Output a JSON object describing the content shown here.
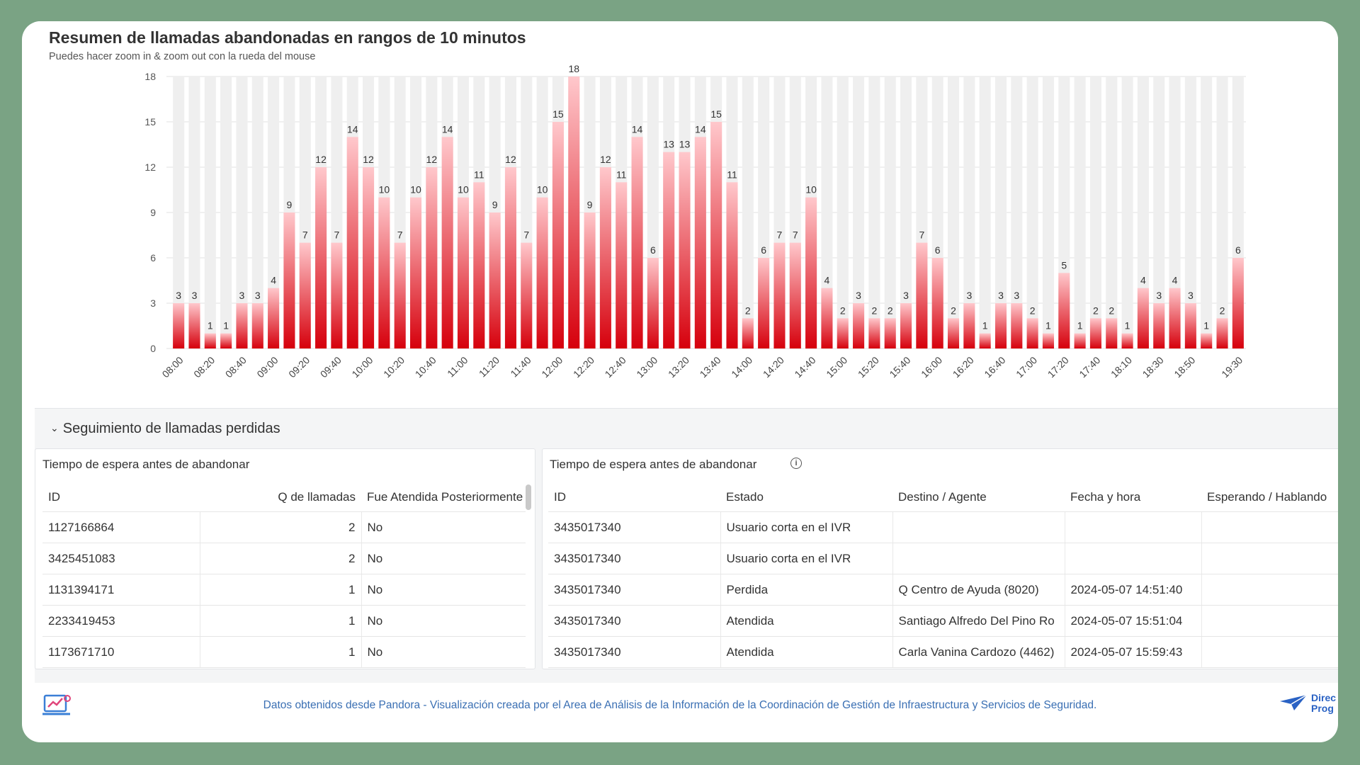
{
  "chart": {
    "title": "Resumen de llamadas abandonadas en rangos de 10 minutos",
    "subtitle": "Puedes hacer zoom in & zoom out con la rueda del mouse"
  },
  "chart_data": {
    "type": "bar",
    "title": "Resumen de llamadas abandonadas en rangos de 10 minutos",
    "xlabel": "",
    "ylabel": "",
    "ylim": [
      0,
      18
    ],
    "yticks": [
      0,
      3,
      6,
      9,
      12,
      15,
      18
    ],
    "categories": [
      "08:00",
      "08:10",
      "08:20",
      "08:30",
      "08:40",
      "08:50",
      "09:00",
      "09:10",
      "09:20",
      "09:30",
      "09:40",
      "09:50",
      "10:00",
      "10:10",
      "10:20",
      "10:30",
      "10:40",
      "10:50",
      "11:00",
      "11:10",
      "11:20",
      "11:30",
      "11:40",
      "11:50",
      "12:00",
      "12:10",
      "12:20",
      "12:30",
      "12:40",
      "12:50",
      "13:00",
      "13:10",
      "13:20",
      "13:30",
      "13:40",
      "13:50",
      "14:00",
      "14:10",
      "14:20",
      "14:30",
      "14:40",
      "14:50",
      "15:00",
      "15:10",
      "15:20",
      "15:30",
      "15:40",
      "15:50",
      "16:00",
      "16:10",
      "16:20",
      "16:30",
      "16:40",
      "16:50",
      "17:00",
      "17:10",
      "17:20",
      "17:30",
      "17:40",
      "17:50",
      "18:10",
      "18:20",
      "18:30",
      "18:40",
      "18:50",
      "19:00",
      "19:10",
      "19:30"
    ],
    "values": [
      3,
      3,
      1,
      1,
      3,
      3,
      4,
      9,
      7,
      12,
      7,
      14,
      12,
      10,
      7,
      10,
      12,
      14,
      10,
      11,
      9,
      12,
      7,
      10,
      15,
      18,
      9,
      12,
      11,
      14,
      6,
      13,
      13,
      14,
      15,
      11,
      2,
      6,
      7,
      7,
      10,
      4,
      2,
      3,
      2,
      2,
      3,
      7,
      6,
      2,
      3,
      1,
      3,
      3,
      2,
      1,
      5,
      1,
      2,
      2,
      1,
      4,
      3,
      4,
      3,
      1,
      2,
      6
    ],
    "shown_tick_labels": [
      "08:00",
      "08:20",
      "08:40",
      "09:00",
      "09:20",
      "09:40",
      "10:00",
      "10:20",
      "10:40",
      "11:00",
      "11:20",
      "11:40",
      "12:00",
      "12:20",
      "12:40",
      "13:00",
      "13:20",
      "13:40",
      "14:00",
      "14:20",
      "14:40",
      "15:00",
      "15:20",
      "15:40",
      "16:00",
      "16:20",
      "16:40",
      "17:00",
      "17:20",
      "17:40",
      "18:10",
      "18:30",
      "18:50",
      "19:30"
    ],
    "colors": {
      "bar_top": "#ffc8cc",
      "bar_bottom": "#d6000c",
      "track": "#efefef",
      "grid": "#e2e2e2"
    },
    "grid": true
  },
  "section": {
    "title": "Seguimiento de llamadas perdidas",
    "chevron": "chevron-down-icon"
  },
  "left_table": {
    "title": "Tiempo de espera antes de abandonar",
    "headers": [
      "ID",
      "Q de llamadas",
      "Fue Atendida Posteriormente"
    ],
    "rows": [
      [
        "1127166864",
        "2",
        "No"
      ],
      [
        "3425451083",
        "2",
        "No"
      ],
      [
        "1131394171",
        "1",
        "No"
      ],
      [
        "2233419453",
        "1",
        "No"
      ],
      [
        "1173671710",
        "1",
        "No"
      ]
    ]
  },
  "right_table": {
    "title": "Tiempo de espera antes de abandonar",
    "info_icon": "info-icon",
    "headers": [
      "ID",
      "Estado",
      "Destino / Agente",
      "Fecha y hora",
      "Esperando / Hablando"
    ],
    "rows": [
      [
        "3435017340",
        "Usuario corta en el IVR",
        "",
        "",
        ""
      ],
      [
        "3435017340",
        "Usuario corta en el IVR",
        "",
        "",
        ""
      ],
      [
        "3435017340",
        "Perdida",
        "Q Centro de Ayuda (8020)",
        "2024-05-07 14:51:40",
        ""
      ],
      [
        "3435017340",
        "Atendida",
        "Santiago Alfredo Del Pino Ro",
        "2024-05-07 15:51:04",
        ""
      ],
      [
        "3435017340",
        "Atendida",
        "Carla Vanina Cardozo (4462)",
        "2024-05-07 15:59:43",
        ""
      ]
    ]
  },
  "footer": {
    "text": "Datos obtenidos desde Pandora - Visualización creada por el Area de Análisis de la Información de la Coordinación de Gestión de Infraestructura y Servicios de Seguridad.",
    "logo_left": "dashboard-laptop-icon",
    "logo_right": {
      "icon": "paper-plane-icon",
      "line1": "Direc",
      "line2": "Prog"
    }
  }
}
